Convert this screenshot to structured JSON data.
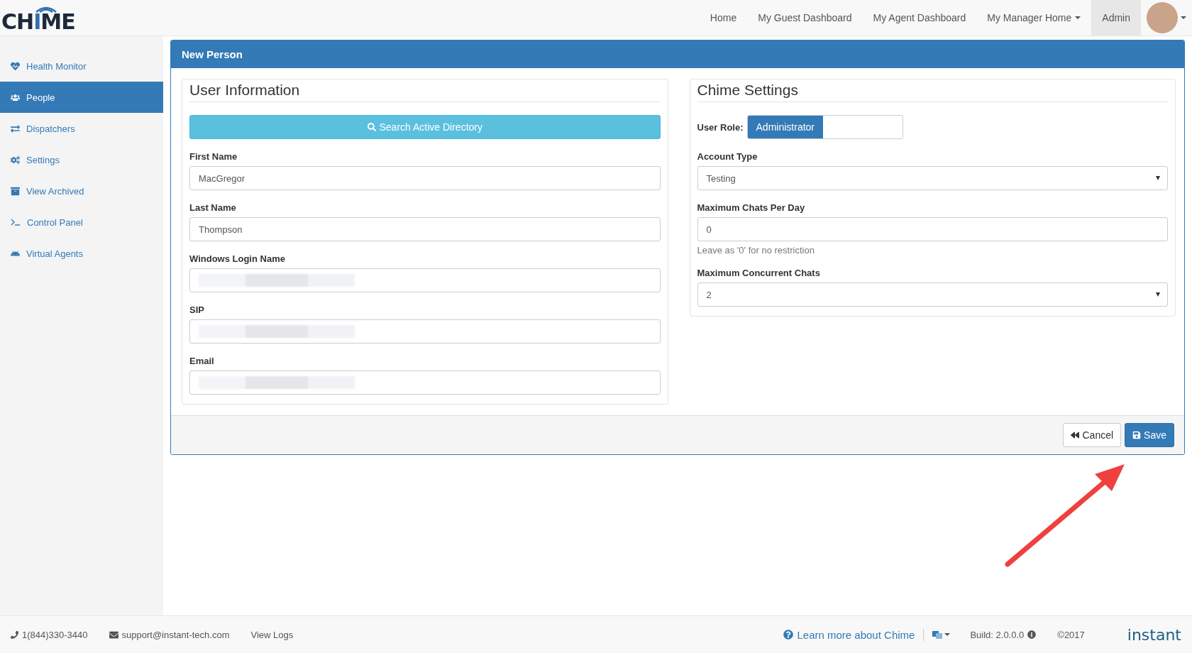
{
  "logo": {
    "parts": [
      {
        "text": "CH",
        "accent": false
      },
      {
        "text": "I",
        "accent": true
      },
      {
        "text": "ME",
        "accent": false
      }
    ]
  },
  "nav": [
    {
      "label": "Home",
      "selected": false,
      "dropdown": false
    },
    {
      "label": "My Guest Dashboard",
      "selected": false,
      "dropdown": false
    },
    {
      "label": "My Agent Dashboard",
      "selected": false,
      "dropdown": false
    },
    {
      "label": "My Manager Home",
      "selected": false,
      "dropdown": true
    },
    {
      "label": "Admin",
      "selected": true,
      "dropdown": false
    }
  ],
  "sidebar": {
    "items": [
      {
        "label": "Health Monitor",
        "selected": false
      },
      {
        "label": "People",
        "selected": true
      },
      {
        "label": "Dispatchers",
        "selected": false
      },
      {
        "label": "Settings",
        "selected": false
      },
      {
        "label": "View Archived",
        "selected": false
      },
      {
        "label": "Control Panel",
        "selected": false
      },
      {
        "label": "Virtual Agents",
        "selected": false
      }
    ]
  },
  "panel": {
    "title": "New Person",
    "user_information": {
      "legend": "User Information",
      "search_button": "Search Active Directory",
      "fields": [
        {
          "label": "First Name",
          "value": "MacGregor",
          "redacted": false
        },
        {
          "label": "Last Name",
          "value": "Thompson",
          "redacted": false
        },
        {
          "label": "Windows Login Name",
          "redacted": true
        },
        {
          "label": "SIP",
          "redacted": true
        },
        {
          "label": "Email",
          "redacted": true
        }
      ]
    },
    "chime_settings": {
      "legend": "Chime Settings",
      "user_role": {
        "label": "User Role:",
        "options": [
          {
            "label": "Administrator",
            "selected": true
          }
        ]
      },
      "fields": [
        {
          "kind": "select",
          "label": "Account Type",
          "value": "Testing"
        },
        {
          "kind": "input",
          "label": "Maximum Chats Per Day",
          "value": "0",
          "help": "Leave as '0' for no restriction"
        },
        {
          "kind": "select",
          "label": "Maximum Concurrent Chats",
          "value": "2"
        }
      ]
    },
    "buttons": [
      {
        "kind": "cancel",
        "label": "Cancel"
      },
      {
        "kind": "save",
        "label": "Save"
      }
    ]
  },
  "footer": {
    "phone": "1(844)330-3440",
    "email": "support@instant-tech.com",
    "view_logs": "View Logs",
    "learn_more": "Learn more about Chime",
    "build": "Build: 2.0.0.0",
    "copyright": "©2017",
    "brand": "instant"
  }
}
